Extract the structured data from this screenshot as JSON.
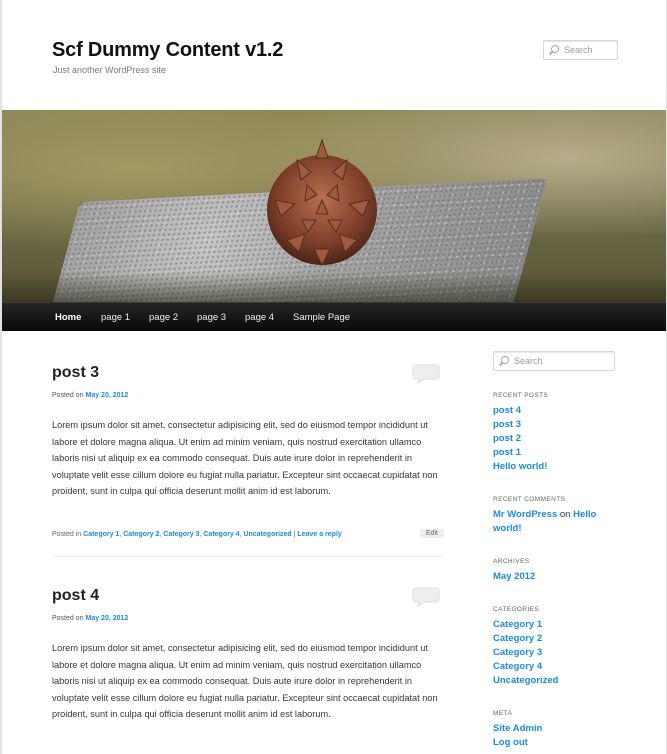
{
  "site": {
    "title": "Scf Dummy Content v1.2",
    "description": "Just another WordPress site"
  },
  "search": {
    "placeholder": "Search"
  },
  "nav": {
    "items": [
      {
        "label": "Home"
      },
      {
        "label": "page 1"
      },
      {
        "label": "page 2"
      },
      {
        "label": "page 3"
      },
      {
        "label": "page 4"
      },
      {
        "label": "Sample Page"
      }
    ]
  },
  "posts": [
    {
      "title": "post 3",
      "posted_on_prefix": "Posted on",
      "date": "May 20, 2012",
      "content": "Lorem ipsum dolor sit amet, consectetur adipisicing elit, sed do eiusmod tempor incididunt ut labore et dolore magna aliqua. Ut enim ad minim veniam, quis nostrud exercitation ullamco laboris nisi ut aliquip ex ea commodo consequat. Duis aute irure dolor in reprehenderit in voluptate velit esse cillum dolore eu fugiat nulla pariatur. Excepteur sint occaecat cupidatat non proident, sunt in culpa qui officia deserunt mollit anim id est laborum.",
      "posted_in_prefix": "Posted in",
      "categories": [
        "Category 1",
        "Category 2",
        "Category 3",
        "Category 4",
        "Uncategorized"
      ],
      "separator": "|",
      "reply_label": "Leave a reply",
      "edit_label": "Edit"
    },
    {
      "title": "post 4",
      "posted_on_prefix": "Posted on",
      "date": "May 20, 2012",
      "content": "Lorem ipsum dolor sit amet, consectetur adipisicing elit, sed do eiusmod tempor incididunt ut labore et dolore magna aliqua. Ut enim ad minim veniam, quis nostrud exercitation ullamco laboris nisi ut aliquip ex ea commodo consequat. Duis aute irure dolor in reprehenderit in voluptate velit esse cillum dolore eu fugiat nulla pariatur. Excepteur sint occaecat cupidatat non proident, sunt in culpa qui officia deserunt mollit anim id est laborum."
    }
  ],
  "sidebar": {
    "recent_posts": {
      "title": "RECENT POSTS",
      "items": [
        "post 4",
        "post 3",
        "post 2",
        "post 1",
        "Hello world!"
      ]
    },
    "recent_comments": {
      "title": "RECENT COMMENTS",
      "author": "Mr WordPress",
      "on": "on",
      "post": "Hello world!"
    },
    "archives": {
      "title": "ARCHIVES",
      "items": [
        "May 2012"
      ]
    },
    "categories": {
      "title": "CATEGORIES",
      "items": [
        "Category 1",
        "Category 2",
        "Category 3",
        "Category 4",
        "Uncategorized"
      ]
    },
    "meta": {
      "title": "META",
      "items": [
        "Site Admin",
        "Log out"
      ]
    }
  },
  "colors": {
    "link": "#1b8be0",
    "nav_bg": "#111111",
    "text": "#373737"
  }
}
